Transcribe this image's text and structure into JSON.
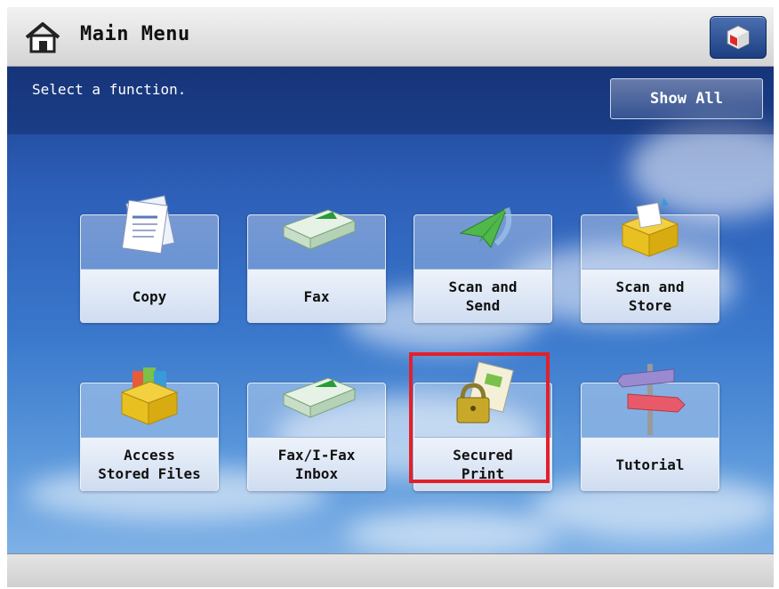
{
  "header": {
    "title": "Main Menu",
    "home_icon": "home-icon",
    "monitor_icon": "status-monitor-icon"
  },
  "main": {
    "prompt": "Select a function.",
    "show_all_label": "Show All",
    "tiles": [
      {
        "label": "Copy",
        "icon": "copy-documents-icon"
      },
      {
        "label": "Fax",
        "icon": "fax-machine-icon"
      },
      {
        "label": "Scan and\nSend",
        "icon": "paper-plane-icon"
      },
      {
        "label": "Scan and\nStore",
        "icon": "storage-box-icon"
      },
      {
        "label": "Access\nStored Files",
        "icon": "files-box-icon"
      },
      {
        "label": "Fax/I-Fax\nInbox",
        "icon": "fax-inbox-icon"
      },
      {
        "label": "Secured\nPrint",
        "icon": "padlock-document-icon"
      },
      {
        "label": "Tutorial",
        "icon": "signpost-icon"
      }
    ]
  },
  "colors": {
    "highlight": "#e3202a",
    "accent": "#2d5fb8"
  }
}
